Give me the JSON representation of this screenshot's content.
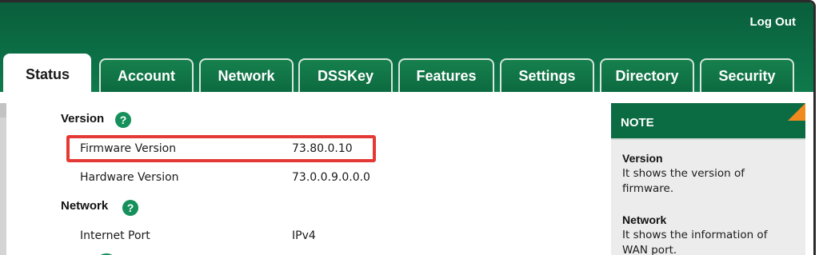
{
  "header": {
    "logout_label": "Log Out"
  },
  "tabs": [
    {
      "label": "Status"
    },
    {
      "label": "Account"
    },
    {
      "label": "Network"
    },
    {
      "label": "DSSKey"
    },
    {
      "label": "Features"
    },
    {
      "label": "Settings"
    },
    {
      "label": "Directory"
    },
    {
      "label": "Security"
    }
  ],
  "version_section": {
    "title": "Version",
    "help_glyph": "?",
    "rows": [
      {
        "label": "Firmware Version",
        "value": "73.80.0.10"
      },
      {
        "label": "Hardware Version",
        "value": "73.0.0.9.0.0.0"
      }
    ]
  },
  "network_section": {
    "title": "Network",
    "help_glyph": "?",
    "rows": [
      {
        "label": "Internet Port",
        "value": "IPv4"
      }
    ]
  },
  "note": {
    "title": "NOTE",
    "items": [
      {
        "heading": "Version",
        "text": "It shows the version of firmware."
      },
      {
        "heading": "Network",
        "text": "It shows the information of WAN port."
      }
    ]
  },
  "colors": {
    "brand_green": "#0b6b43",
    "help_icon_green": "#15905a",
    "highlight_red": "#e53935",
    "note_corner_orange": "#f08a1e"
  }
}
